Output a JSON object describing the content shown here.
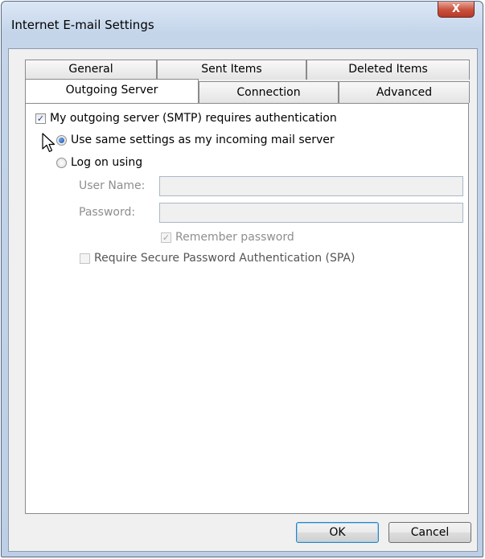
{
  "window": {
    "title": "Internet E-mail Settings",
    "close_glyph": "X"
  },
  "tabs": {
    "row1": [
      {
        "label": "General"
      },
      {
        "label": "Sent Items"
      },
      {
        "label": "Deleted Items"
      }
    ],
    "row2": [
      {
        "label": "Outgoing Server",
        "active": true
      },
      {
        "label": "Connection"
      },
      {
        "label": "Advanced"
      }
    ]
  },
  "outgoing": {
    "requires_auth": {
      "label": "My outgoing server (SMTP) requires authentication",
      "checked": true
    },
    "same_settings": {
      "label": "Use same settings as my incoming mail server",
      "selected": true
    },
    "log_on_using": {
      "label": "Log on using",
      "selected": false
    },
    "user_name": {
      "label": "User Name:",
      "value": ""
    },
    "password": {
      "label": "Password:",
      "value": ""
    },
    "remember_password": {
      "label": "Remember password",
      "checked": true,
      "disabled": true
    },
    "spa": {
      "label": "Require Secure Password Authentication (SPA)",
      "checked": false
    }
  },
  "buttons": {
    "ok": "OK",
    "cancel": "Cancel"
  },
  "icons": {
    "check": "✓",
    "cursor": "mouse-pointer-icon"
  }
}
